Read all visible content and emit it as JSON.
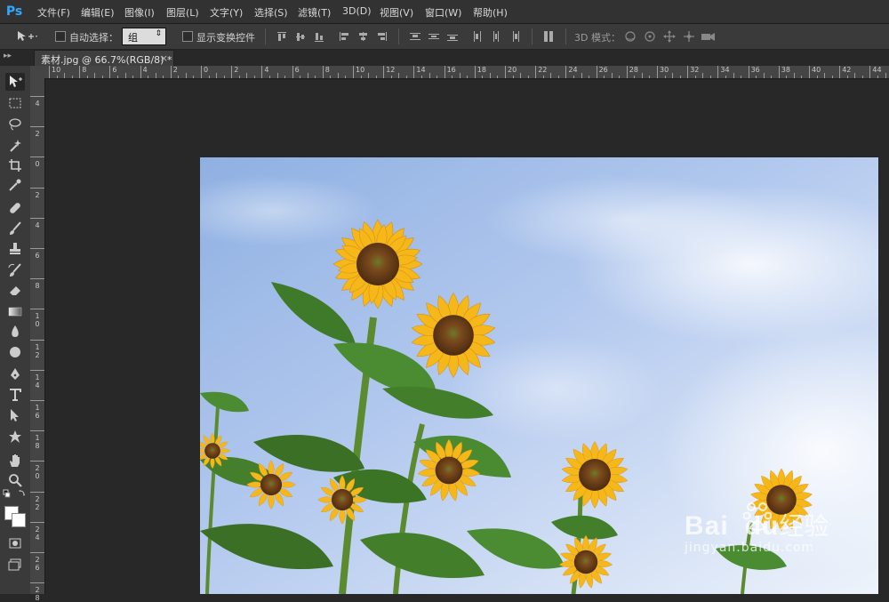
{
  "app": {
    "logo": "Ps"
  },
  "menu": {
    "items": [
      "文件(F)",
      "编辑(E)",
      "图像(I)",
      "图层(L)",
      "文字(Y)",
      "选择(S)",
      "滤镜(T)",
      "3D(D)",
      "视图(V)",
      "窗口(W)",
      "帮助(H)"
    ]
  },
  "options": {
    "auto_select_label": "自动选择：",
    "auto_select_value": "组",
    "show_transform_label": "显示变换控件",
    "mode_3d_label": "3D 模式："
  },
  "document": {
    "tab_title": "素材.jpg @ 66.7%(RGB/8) *",
    "close_glyph": "×",
    "zoom": "66.7%"
  },
  "rulers": {
    "h_labels": [
      "10",
      "8",
      "6",
      "4",
      "2",
      "0",
      "2",
      "4",
      "6",
      "8",
      "10",
      "12",
      "14",
      "16",
      "18",
      "20",
      "22",
      "24",
      "26",
      "28",
      "30",
      "32",
      "34",
      "36",
      "38",
      "40",
      "42",
      "44"
    ],
    "v_labels": [
      "4",
      "2",
      "0",
      "2",
      "4",
      "6",
      "8",
      "10",
      "12",
      "14",
      "16",
      "18",
      "20",
      "22",
      "24",
      "26",
      "28"
    ]
  },
  "watermark": {
    "brand": "Bai",
    "brand2": "du",
    "cn": "经验",
    "url": "jingyan.baidu.com"
  },
  "colors": {
    "foreground": "#ffffff",
    "background": "#ffffff",
    "sky": "#a9c3eb",
    "petal": "#f5b719"
  }
}
